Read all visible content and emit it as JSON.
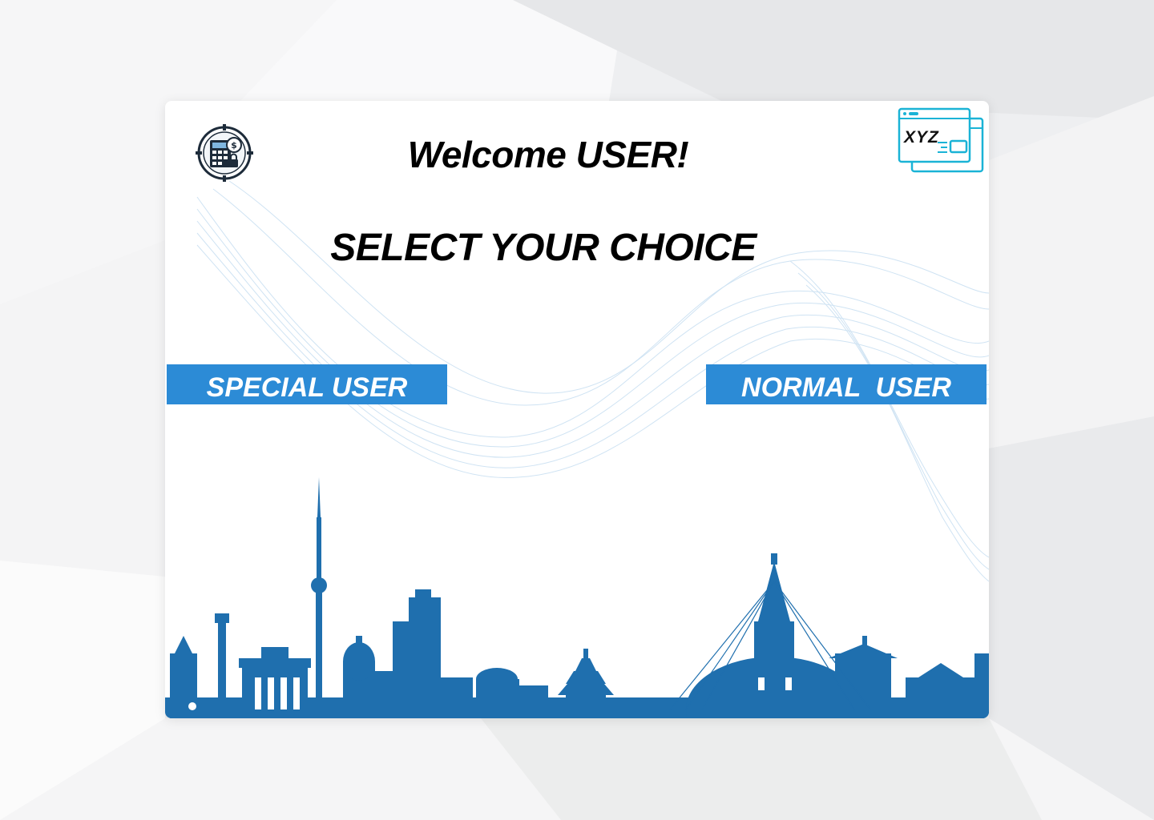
{
  "header": {
    "welcome_text": "Welcome USER!",
    "logo_right_text": "XYZ"
  },
  "main": {
    "title": "SELECT YOUR CHOICE",
    "special_user_label": "SPECIAL USER",
    "normal_user_label": "NORMAL  USER"
  },
  "colors": {
    "button": "#2c8bd6",
    "skyline": "#1f6fae",
    "logo_accent": "#1ab3d6"
  },
  "icons": {
    "left_logo": "calculator-money-lock-icon",
    "right_logo": "browser-windows-icon"
  }
}
